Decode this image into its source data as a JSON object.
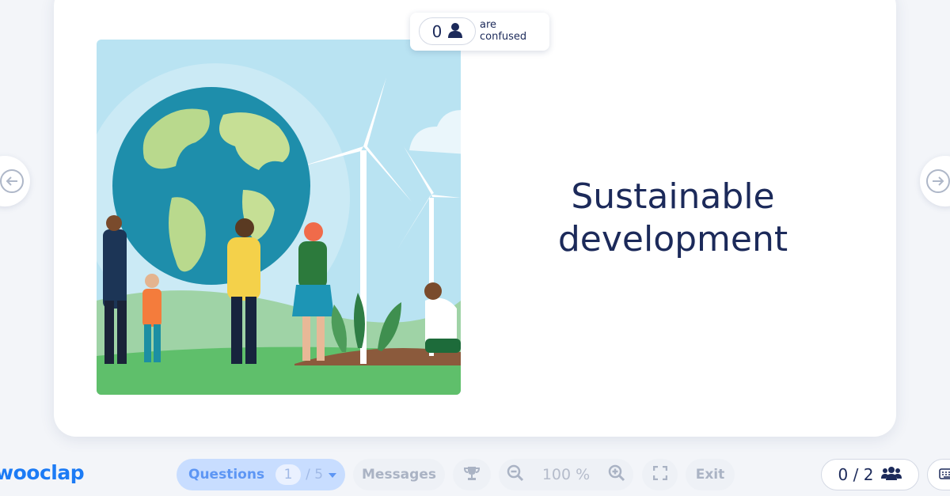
{
  "slide": {
    "title": "Sustainable development",
    "illustration": "people-holding-earth-wind-turbines"
  },
  "confused": {
    "count": "0",
    "label_line1": "are",
    "label_line2": "confused",
    "icon": "person-icon"
  },
  "nav": {
    "prev_icon": "arrow-left-icon",
    "next_icon": "arrow-right-icon"
  },
  "toolbar": {
    "logo": "wooclap",
    "questions_label": "Questions",
    "questions_current": "1",
    "questions_total": "/ 5",
    "messages_label": "Messages",
    "zoom_value": "100 %",
    "exit_label": "Exit",
    "participants": "0 / 2"
  },
  "colors": {
    "accent": "#1c7bf5",
    "title": "#1c2a5a",
    "questions_bg": "#c8ddff"
  }
}
